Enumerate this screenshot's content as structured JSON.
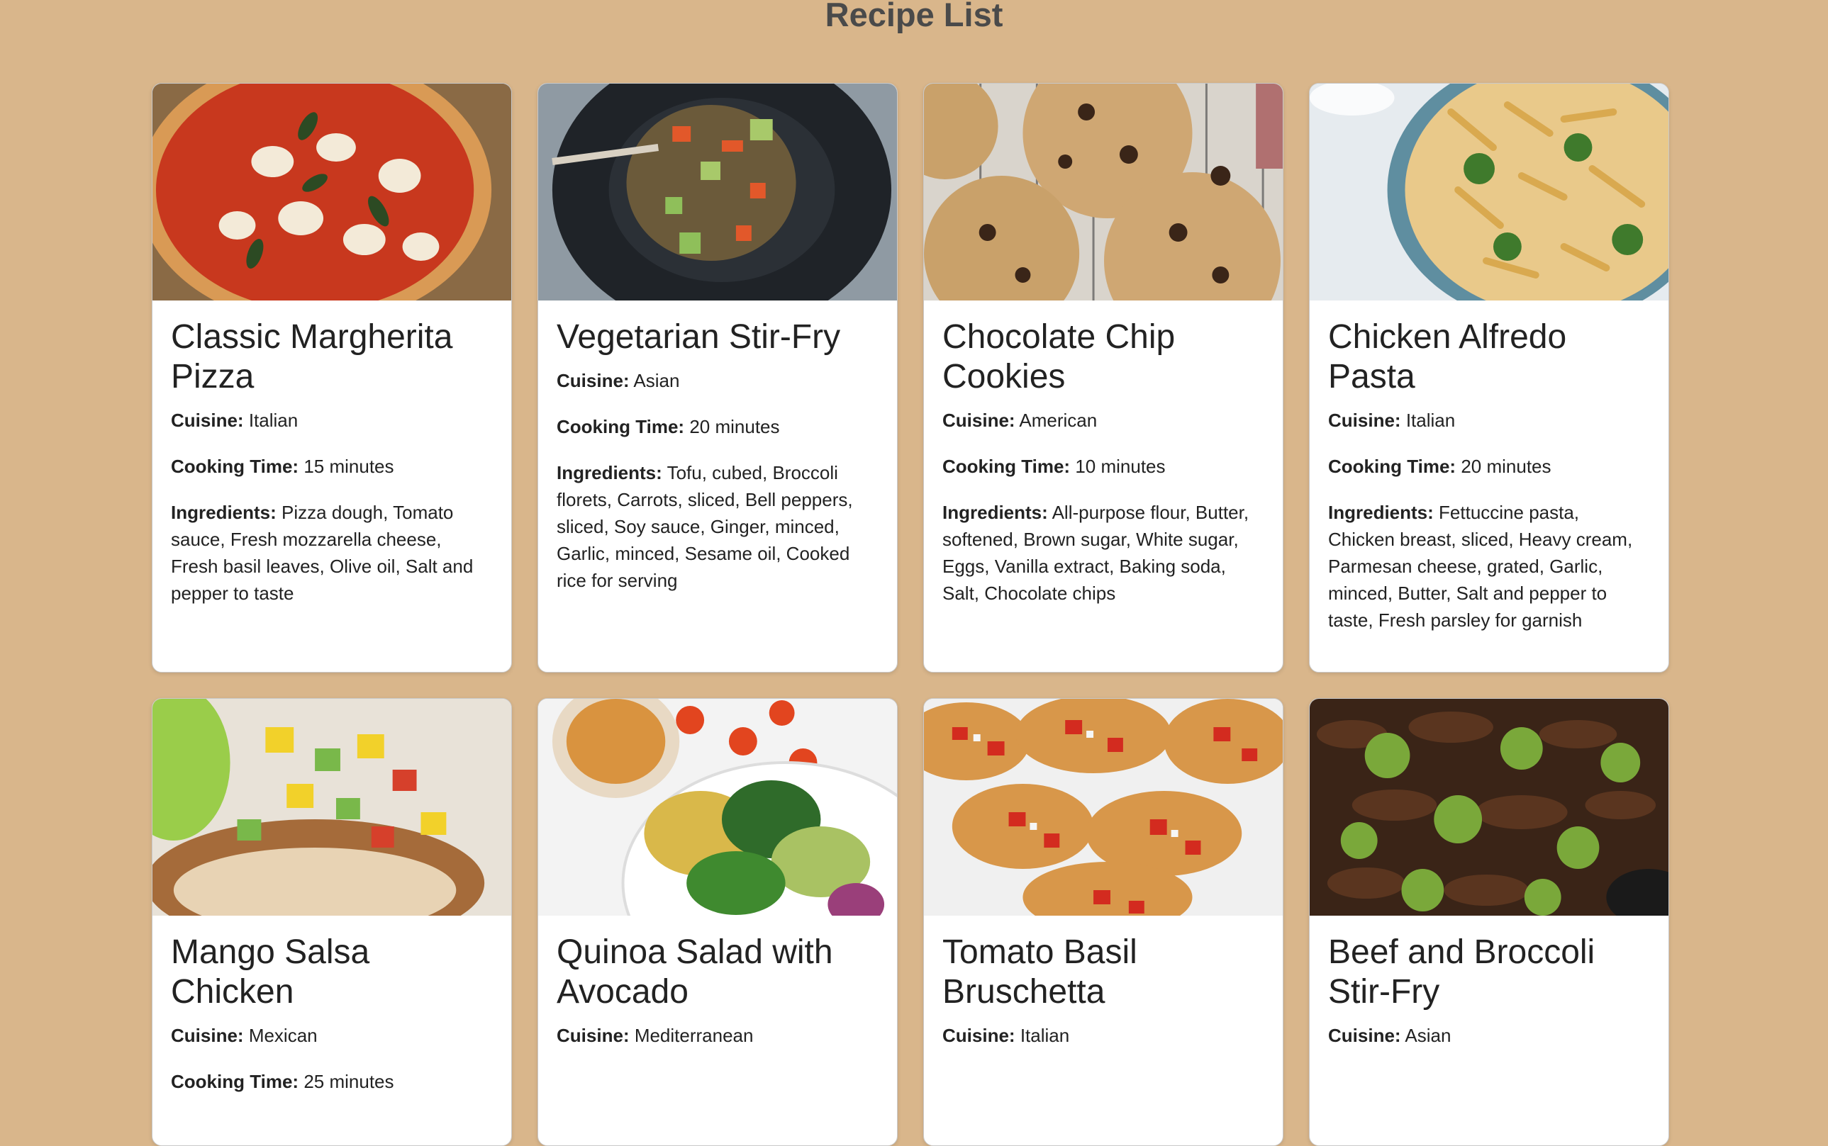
{
  "page": {
    "title": "Recipe List"
  },
  "labels": {
    "cuisine": "Cuisine:",
    "cooking_time": "Cooking Time:",
    "ingredients": "Ingredients:"
  },
  "recipes": [
    {
      "title": "Classic Margherita Pizza",
      "cuisine": "Italian",
      "cooking_time": "15 minutes",
      "ingredients": "Pizza dough, Tomato sauce, Fresh mozzarella cheese, Fresh basil leaves, Olive oil, Salt and pepper to taste",
      "image": "pizza-photo"
    },
    {
      "title": "Vegetarian Stir-Fry",
      "cuisine": "Asian",
      "cooking_time": "20 minutes",
      "ingredients": "Tofu, cubed, Broccoli florets, Carrots, sliced, Bell peppers, sliced, Soy sauce, Ginger, minced, Garlic, minced, Sesame oil, Cooked rice for serving",
      "image": "stir-fry-photo"
    },
    {
      "title": "Chocolate Chip Cookies",
      "cuisine": "American",
      "cooking_time": "10 minutes",
      "ingredients": "All-purpose flour, Butter, softened, Brown sugar, White sugar, Eggs, Vanilla extract, Baking soda, Salt, Chocolate chips",
      "image": "cookies-photo"
    },
    {
      "title": "Chicken Alfredo Pasta",
      "cuisine": "Italian",
      "cooking_time": "20 minutes",
      "ingredients": "Fettuccine pasta, Chicken breast, sliced, Heavy cream, Parmesan cheese, grated, Garlic, minced, Butter, Salt and pepper to taste, Fresh parsley for garnish",
      "image": "pasta-photo"
    },
    {
      "title": "Mango Salsa Chicken",
      "cuisine": "Mexican",
      "cooking_time": "25 minutes",
      "image": "mango-chicken-photo"
    },
    {
      "title": "Quinoa Salad with Avocado",
      "cuisine": "Mediterranean",
      "image": "quinoa-salad-photo"
    },
    {
      "title": "Tomato Basil Bruschetta",
      "cuisine": "Italian",
      "image": "bruschetta-photo"
    },
    {
      "title": "Beef and Broccoli Stir-Fry",
      "cuisine": "Asian",
      "image": "beef-broccoli-photo"
    }
  ]
}
